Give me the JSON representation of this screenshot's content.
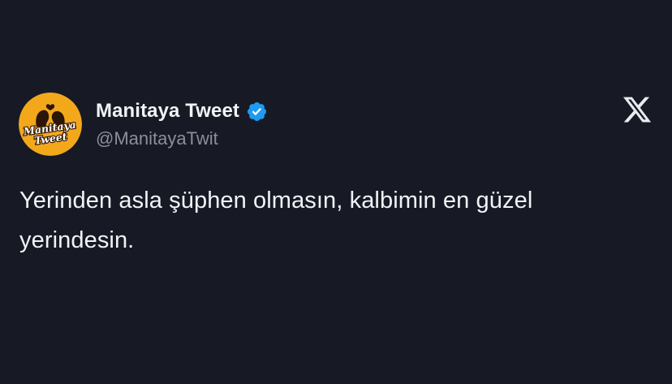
{
  "author": {
    "display_name": "Manitaya Tweet",
    "handle": "@ManitayaTwit",
    "verified": true,
    "avatar": {
      "icon": "couple-silhouette-logo",
      "text_line1": "Manitaya",
      "text_line2": "Tweet",
      "colors": {
        "background": "#f3a81c",
        "silhouette": "#2b1608",
        "text_fill": "#ffffff",
        "text_stroke": "#3a1c08"
      }
    }
  },
  "tweet": {
    "text": "Yerinden asla şüphen olmasın, kalbimin en güzel yerindesin."
  },
  "icons": {
    "verified": "verified-badge-icon",
    "platform": "x-logo-icon"
  },
  "colors": {
    "background": "#171a24",
    "text_primary": "#f1f3f7",
    "text_secondary": "#8b8f99",
    "verified_blue": "#1d9bf0"
  }
}
